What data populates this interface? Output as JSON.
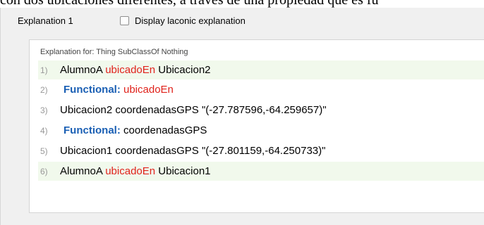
{
  "caption": "con dos ubicaciones diferentes, a través de una propiedad que es fu",
  "panel": {
    "title": "Explanation 1",
    "laconic_checkbox_label": "Display laconic explanation"
  },
  "explanation": {
    "header": "Explanation for: Thing SubClassOf Nothing",
    "lines": [
      {
        "num": "1)",
        "parts": [
          "AlumnoA",
          "ubicadoEn",
          "Ubicacion2"
        ]
      },
      {
        "num": "2)",
        "keyword": "Functional:",
        "property": "ubicadoEn"
      },
      {
        "num": "3)",
        "text": "Ubicacion2 coordenadasGPS \"(-27.787596,-64.259657)\""
      },
      {
        "num": "4)",
        "keyword": "Functional:",
        "property": "coordenadasGPS"
      },
      {
        "num": "5)",
        "text": "Ubicacion1 coordenadasGPS \"(-27.801159,-64.250733)\""
      },
      {
        "num": "6)",
        "parts": [
          "AlumnoA",
          "ubicadoEn",
          "Ubicacion1"
        ]
      }
    ]
  },
  "colors": {
    "object_property": "#e0221b",
    "keyword": "#1a5fb4",
    "highlight_row": "#f1f9ec"
  }
}
